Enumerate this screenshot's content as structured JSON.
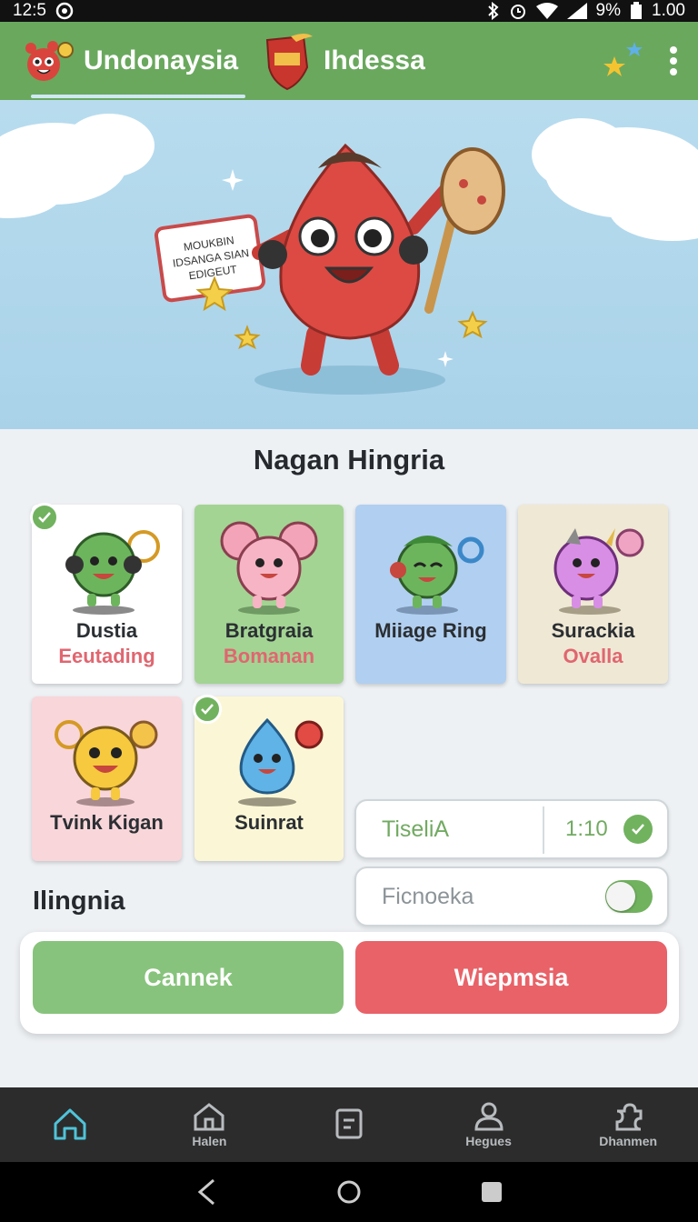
{
  "status_bar": {
    "time": "12:5",
    "battery": "9%",
    "signal_text": "1.00"
  },
  "app_bar": {
    "tabs": [
      {
        "label": "Undonaysia",
        "active": true
      },
      {
        "label": "Ihdessa",
        "active": false
      }
    ],
    "icons": [
      "stars-icon",
      "more-vert-icon"
    ]
  },
  "hero": {
    "sign_text_1": "MOUKBIN",
    "sign_text_2": "IDSANGA SIAN",
    "sign_text_3": "EDIGEUT"
  },
  "section_title": "Nagan Hingria",
  "cards": [
    {
      "title": "Dustia",
      "subtitle": "Eeutading",
      "checked": true,
      "bg": "#ffffff"
    },
    {
      "title": "Bratgraia",
      "subtitle": "Bomanan",
      "checked": false,
      "bg": "#a3d493"
    },
    {
      "title": "Miiage Ring",
      "subtitle": "",
      "checked": false,
      "bg": "#b1cff0"
    },
    {
      "title": "Surackia",
      "subtitle": "Ovalla",
      "checked": false,
      "bg": "#efe8d4"
    },
    {
      "title": "Tvink Kigan",
      "subtitle": "",
      "checked": false,
      "bg": "#f8d6da"
    },
    {
      "title": "Suinrat",
      "subtitle": "",
      "checked": true,
      "bg": "#fbf7d6"
    }
  ],
  "sub_heading": "Ilingnia",
  "field_one": {
    "label": "TiseliA",
    "value": "1:10"
  },
  "field_two": {
    "label": "Ficnoeka",
    "toggle_on": true
  },
  "actions": {
    "primary": "Cannek",
    "secondary": "Wiepmsia"
  },
  "bottom_nav": [
    {
      "label": "",
      "icon": "home-icon",
      "active": true
    },
    {
      "label": "Halen",
      "icon": "house-icon",
      "active": false
    },
    {
      "label": "",
      "icon": "document-icon",
      "active": false
    },
    {
      "label": "Hegues",
      "icon": "person-icon",
      "active": false
    },
    {
      "label": "Dhanmen",
      "icon": "puzzle-icon",
      "active": false
    }
  ],
  "colors": {
    "accent": "#6aa85e",
    "primary_btn": "#87c37c",
    "danger_btn": "#e86268",
    "active_nav": "#4fc3d9"
  }
}
